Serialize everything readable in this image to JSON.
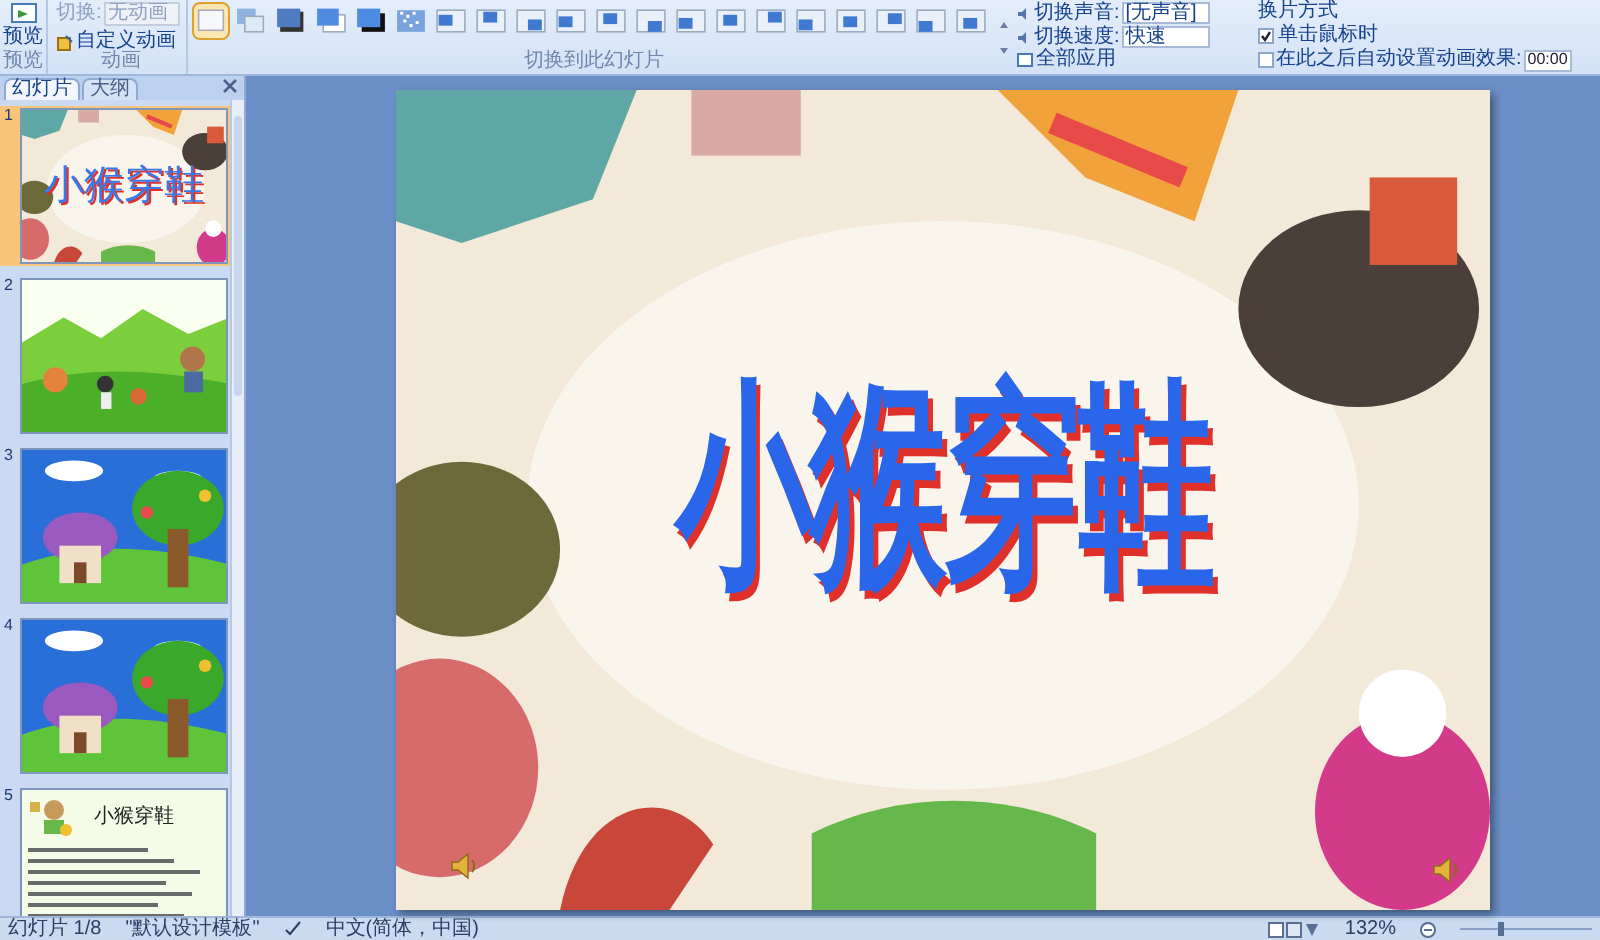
{
  "ribbon": {
    "preview_button": "预览",
    "transition_field": {
      "label": "切换:",
      "value": "无动画"
    },
    "custom_animation_button": "自定义动画",
    "group_labels": [
      "预览",
      "动画",
      "切换到此幻灯片"
    ],
    "transitions": [
      {
        "selected": true
      },
      {
        "selected": false
      },
      {
        "selected": false
      },
      {
        "selected": false
      },
      {
        "selected": false
      },
      {
        "selected": false
      },
      {
        "selected": false
      },
      {
        "selected": false
      },
      {
        "selected": false
      },
      {
        "selected": false
      },
      {
        "selected": false
      },
      {
        "selected": false
      },
      {
        "selected": false
      },
      {
        "selected": false
      },
      {
        "selected": false
      },
      {
        "selected": false
      },
      {
        "selected": false
      },
      {
        "selected": false
      },
      {
        "selected": false
      },
      {
        "selected": false
      }
    ],
    "sound": {
      "label": "切换声音:",
      "value": "[无声音]"
    },
    "speed": {
      "label": "切换速度:",
      "value": "快速"
    },
    "apply_all_button": "全部应用",
    "advance_heading": "换片方式",
    "on_click": {
      "label": "单击鼠标时",
      "checked": true
    },
    "after": {
      "label": "在此之后自动设置动画效果:",
      "checked": false,
      "value": "00:00"
    }
  },
  "pane": {
    "tabs": [
      {
        "label": "幻灯片",
        "selected": true
      },
      {
        "label": "大纲",
        "selected": false
      }
    ],
    "slides": [
      {
        "number": "1",
        "kind": "title",
        "title": "小猴穿鞋",
        "selected": true
      },
      {
        "number": "2",
        "kind": "meadow",
        "selected": false
      },
      {
        "number": "3",
        "kind": "house",
        "selected": false
      },
      {
        "number": "4",
        "kind": "house",
        "selected": false
      },
      {
        "number": "5",
        "kind": "text",
        "title": "小猴穿鞋",
        "selected": false
      }
    ]
  },
  "slide": {
    "title": "小猴穿鞋"
  },
  "status_bar": {
    "slide_index": "幻灯片 1/8",
    "theme": "\"默认设计模板\"",
    "language": "中文(简体，中国)",
    "zoom": "132%",
    "zoom_slider": {
      "level": 0.3
    }
  }
}
